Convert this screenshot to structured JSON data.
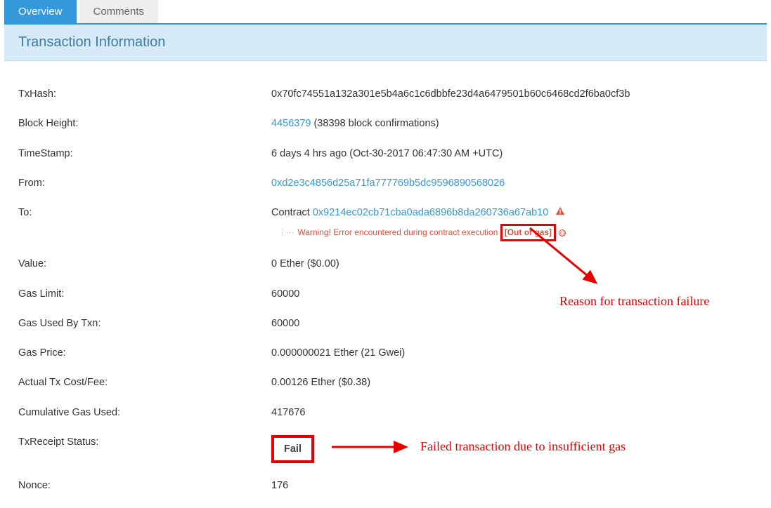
{
  "tabs": {
    "overview": "Overview",
    "comments": "Comments"
  },
  "panel_title": "Transaction Information",
  "fields": {
    "txhash": {
      "label": "TxHash:",
      "value": "0x70fc74551a132a301e5b4a6c1c6dbbfe23d4a6479501b60c6468cd2f6ba0cf3b"
    },
    "block": {
      "label": "Block Height:",
      "link": "4456379",
      "suffix": " (38398 block confirmations)"
    },
    "timestamp": {
      "label": "TimeStamp:",
      "value": "6 days 4 hrs ago (Oct-30-2017 06:47:30 AM +UTC)"
    },
    "from": {
      "label": "From:",
      "value": "0xd2e3c4856d25a71fa777769b5dc9596890568026"
    },
    "to": {
      "label": "To:",
      "prefix": "Contract ",
      "address": "0x9214ec02cb71cba0ada6896b8da260736a67ab10",
      "warning_pre": "Warning! Error encountered during contract execution ",
      "warning_tag": "[Out of gas]"
    },
    "value": {
      "label": "Value:",
      "value": "0 Ether ($0.00)"
    },
    "gaslimit": {
      "label": "Gas Limit:",
      "value": "60000"
    },
    "gasused": {
      "label": "Gas Used By Txn:",
      "value": "60000"
    },
    "gasprice": {
      "label": "Gas Price:",
      "value": "0.000000021 Ether (21 Gwei)"
    },
    "cost": {
      "label": "Actual Tx Cost/Fee:",
      "value": "0.00126 Ether ($0.38)"
    },
    "cumgas": {
      "label": "Cumulative Gas Used:",
      "value": "417676"
    },
    "receipt": {
      "label": "TxReceipt Status:",
      "value": "Fail"
    },
    "nonce": {
      "label": "Nonce:",
      "value": "176"
    }
  },
  "annotations": {
    "reason": "Reason for transaction failure",
    "failed": "Failed transaction due to insufficient gas"
  }
}
